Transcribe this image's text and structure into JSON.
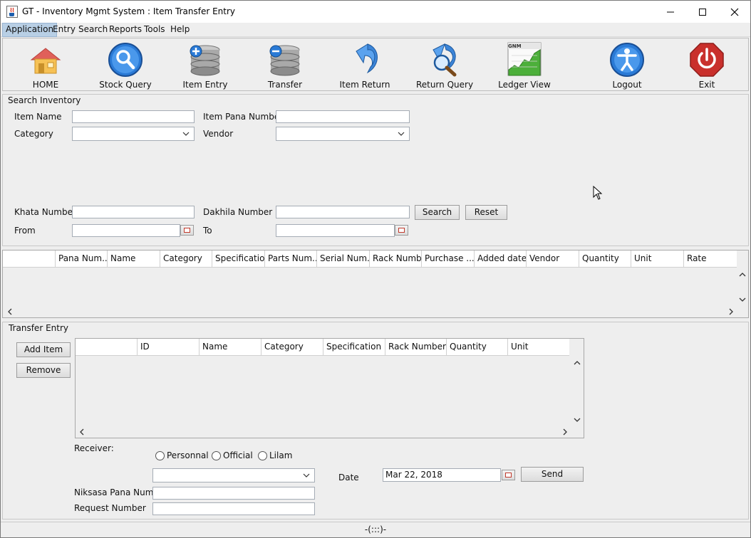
{
  "window": {
    "title": "GT - Inventory Mgmt System : Item Transfer Entry"
  },
  "menu": [
    "Application",
    "Entry",
    "Search",
    "Reports",
    "Tools",
    "Help"
  ],
  "toolbar": [
    {
      "label": "HOME",
      "icon": "home-icon"
    },
    {
      "label": "Stock Query",
      "icon": "magnifier-icon"
    },
    {
      "label": "Item Entry",
      "icon": "database-add-icon"
    },
    {
      "label": "Transfer",
      "icon": "database-remove-icon"
    },
    {
      "label": "Item Return",
      "icon": "return-arrow-icon"
    },
    {
      "label": "Return Query",
      "icon": "return-search-icon"
    },
    {
      "label": "Ledger View",
      "icon": "ledger-chart-icon"
    },
    {
      "label": "Logout",
      "icon": "person-icon"
    },
    {
      "label": "Exit",
      "icon": "power-icon"
    }
  ],
  "ledger_icon_text": "GNM",
  "search": {
    "title": "Search Inventory",
    "item_name_label": "Item Name",
    "item_pana_label": "Item Pana Number",
    "category_label": "Category",
    "vendor_label": "Vendor",
    "khata_label": "Khata Number",
    "dakhila_label": "Dakhila Number",
    "from_label": "From",
    "to_label": "To",
    "search_button": "Search",
    "reset_button": "Reset"
  },
  "results_table": {
    "columns": [
      "",
      "Pana Num...",
      "Name",
      "Category",
      "Specification",
      "Parts Num...",
      "Serial Num...",
      "Rack Number",
      "Purchase ...",
      "Added date",
      "Vendor",
      "Quantity",
      "Unit",
      "Rate"
    ]
  },
  "transfer": {
    "title": "Transfer Entry",
    "add_button": "Add Item",
    "remove_button": "Remove",
    "columns": [
      "",
      "ID",
      "Name",
      "Category",
      "Specification",
      "Rack Number",
      "Quantity",
      "Unit"
    ],
    "receiver_label": "Receiver:",
    "receiver_options": [
      "Personnal",
      "Official",
      "Lilam"
    ],
    "date_label": "Date",
    "date_value": "Mar 22, 2018",
    "send_button": "Send",
    "niksasa_label": "Niksasa Pana Number",
    "request_label": "Request Number"
  },
  "status": "-(:::)-",
  "colors": {
    "background": "#eeeeee",
    "menu_highlight": "#b8cfe5",
    "border": "#b9b9b9"
  }
}
